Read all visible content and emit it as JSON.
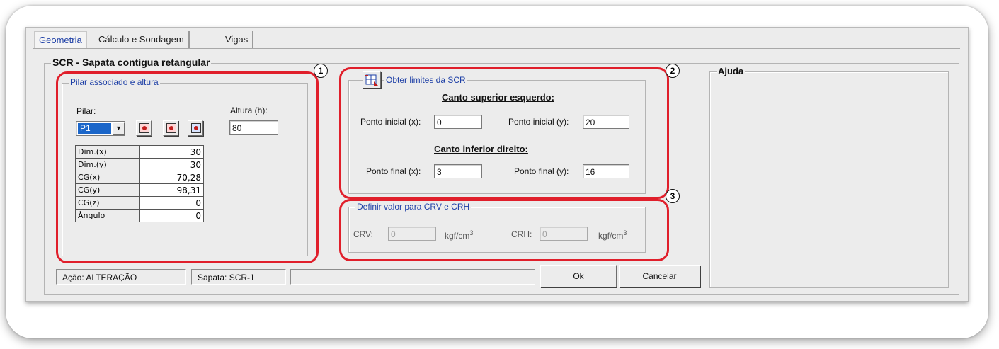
{
  "tabs": [
    "Geometria",
    "Cálculo e Sondagem",
    "Vigas"
  ],
  "main_group": "SCR - Sapata contígua retangular",
  "pillar_group": {
    "title": "Pilar associado e altura",
    "pilar_label": "Pilar:",
    "pilar_value": "P1",
    "height_label": "Altura (h):",
    "height_value": "80",
    "dims": [
      {
        "k": "Dim.(x)",
        "v": "30"
      },
      {
        "k": "Dim.(y)",
        "v": "30"
      },
      {
        "k": "CG(x)",
        "v": "70,28"
      },
      {
        "k": "CG(y)",
        "v": "98,31"
      },
      {
        "k": "CG(z)",
        "v": "0"
      },
      {
        "k": "Ângulo",
        "v": "0"
      }
    ]
  },
  "limits_group": {
    "title": "Obter limites da SCR",
    "upper_left_title": "Canto superior esquerdo:",
    "start_x_label": "Ponto inicial (x):",
    "start_x_value": "0",
    "start_y_label": "Ponto inicial (y):",
    "start_y_value": "20",
    "lower_right_title": "Canto inferior direito:",
    "end_x_label": "Ponto final (x):",
    "end_x_value": "3",
    "end_y_label": "Ponto final (y):",
    "end_y_value": "16"
  },
  "crv_group": {
    "title": "Definir valor para CRV e CRH",
    "crv_label": "CRV:",
    "crv_value": "0",
    "crh_label": "CRH:",
    "crh_value": "0",
    "unit": "kgf/cm",
    "unit_exp": "3"
  },
  "help_group": {
    "title": "Ajuda"
  },
  "annotations": [
    "1",
    "2",
    "3"
  ],
  "status": {
    "action": "Ação: ALTERAÇÃO",
    "sapata": "Sapata: SCR-1",
    "extra": ""
  },
  "buttons": {
    "ok": "Ok",
    "cancel": "Cancelar"
  },
  "colors": {
    "annotation_red": "#e01f2b",
    "title_blue": "#1d3fa6"
  }
}
